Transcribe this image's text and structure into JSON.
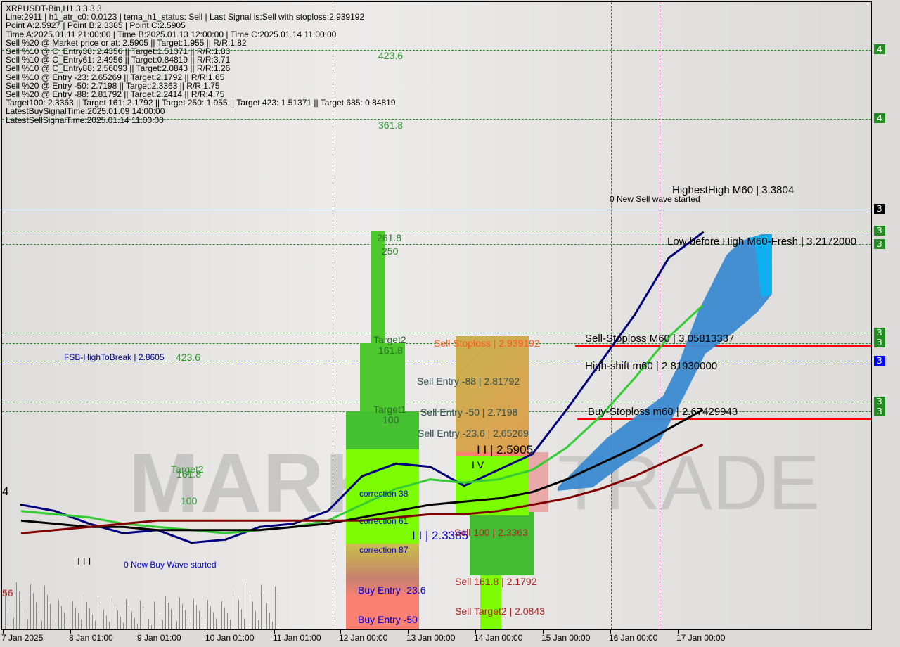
{
  "header": {
    "symbol_line": "XRPUSDT-Bin,H1  3 3 3 3",
    "info_lines": [
      "Line:2911 | h1_atr_c0: 0.0123 | tema_h1_status: Sell | Last Signal is:Sell with stoploss:2.939192",
      "Point A:2.5927 | Point B:2.3385 | Point C:2.5905",
      "Time A:2025.01.11 21:00:00 | Time B:2025.01.13 12:00:00 | Time C:2025.01.14 11:00:00",
      "Sell %20 @ Market price or at: 2.5905 || Target:1.955 || R/R:1.82",
      "Sell %10 @ C_Entry38: 2.4356 || Target:1.51371 || R/R:1.83",
      "Sell %10 @ C_Entry61: 2.4956 || Target:0.84819 || R/R:3.71",
      "Sell %10 @ C_Entry88: 2.56093 || Target:2.0843 || R/R:1.26",
      "Sell %10 @ Entry -23: 2.65269 || Target:2.1792 || R/R:1.65",
      "Sell %20 @ Entry -50: 2.7198 || Target:2.3363 || R/R:1.75",
      "Sell %20 @ Entry -88: 2.81792 || Target:2.2414 || R/R:4.75",
      "Target100: 2.3363 || Target 161: 2.1792 || Target 250: 1.955 || Target 423: 1.51371 || Target 685: 0.84819",
      "LatestBuySignalTime:2025.01.09 14:00:00",
      "LatestSellSignalTime:2025.01.14 11:00:00"
    ]
  },
  "watermark": "MARKET TRADE",
  "labels": {
    "l423a": "423.6",
    "l361": "361.8",
    "l261": "261.8",
    "l250": "250",
    "target2": "Target2",
    "t161": "161.8",
    "target1": "Target1",
    "t100": "100",
    "fsb": "FSB-HighToBreak | 2.8605",
    "l423b": "423.6",
    "ltarget2": "Target2",
    "l161": "161.8",
    "l100": "100",
    "sell_stoploss": "Sell Stoploss | 2.939192",
    "sell_e88": "Sell Entry -88 | 2.81792",
    "sell_e50": "Sell Entry -50 | 2.7198",
    "sell_e236": "Sell Entry -23.6 | 2.65269",
    "pointc": "I I | 2.5905",
    "iv": "I V",
    "pointb": "I I | 2.3385",
    "sell100": "Sell 100 | 2.3363",
    "sell161": "Sell 161.8 | 2.1792",
    "sellt2": "Sell Target2 | 2.0843",
    "c38": "correction 38",
    "c61": "correction 61",
    "c87": "correction 87",
    "be236": "Buy Entry -23.6",
    "be50": "Buy Entry -50",
    "highesthigh": "HighestHigh    M60 | 3.3804",
    "newsell": "0 New Sell wave started",
    "lowbefore": "Low before High   M60-Fresh | 3.2172000",
    "sellsl": "Sell-Stoploss M60 | 3.05813337",
    "highshift": "High-shift m60 | 2.81930000",
    "buysl": "Buy-Stoploss m60 | 2.67429943",
    "newbuy": "0 New Buy Wave started",
    "left4": "4",
    "left56": "56",
    "iii": "I I I"
  },
  "axis_tags": [
    {
      "text": "4",
      "color": "#228b22"
    },
    {
      "text": "4",
      "color": "#228b22"
    },
    {
      "text": "3",
      "color": "#000000"
    },
    {
      "text": "3",
      "color": "#228b22"
    },
    {
      "text": "3",
      "color": "#228b22"
    },
    {
      "text": "3",
      "color": "#228b22"
    },
    {
      "text": "3",
      "color": "#228b22"
    },
    {
      "text": "3",
      "color": "#0000ff"
    },
    {
      "text": "3",
      "color": "#228b22"
    },
    {
      "text": "3",
      "color": "#228b22"
    }
  ],
  "chart_data": {
    "type": "line",
    "title": "XRPUSDT-Bin,H1",
    "x_ticks": [
      "7 Jan 2025",
      "8 Jan 01:00",
      "9 Jan 01:00",
      "10 Jan 01:00",
      "11 Jan 01:00",
      "12 Jan 00:00",
      "13 Jan 00:00",
      "14 Jan 00:00",
      "15 Jan 00:00",
      "16 Jan 00:00",
      "17 Jan 00:00"
    ],
    "x": [
      "2025-01-07 00:00",
      "2025-01-07 12:00",
      "2025-01-08 00:00",
      "2025-01-08 12:00",
      "2025-01-09 00:00",
      "2025-01-09 12:00",
      "2025-01-10 00:00",
      "2025-01-10 12:00",
      "2025-01-11 00:00",
      "2025-01-11 12:00",
      "2025-01-12 00:00",
      "2025-01-12 12:00",
      "2025-01-13 00:00",
      "2025-01-13 12:00",
      "2025-01-14 00:00",
      "2025-01-14 12:00",
      "2025-01-15 00:00",
      "2025-01-15 12:00",
      "2025-01-16 00:00",
      "2025-01-16 12:00",
      "2025-01-17 00:00"
    ],
    "series": [
      {
        "color": "#000080",
        "values": [
          2.42,
          2.4,
          2.36,
          2.33,
          2.34,
          2.3,
          2.31,
          2.35,
          2.36,
          2.4,
          2.51,
          2.55,
          2.54,
          2.48,
          2.53,
          2.58,
          2.72,
          2.87,
          3.02,
          3.2,
          3.28
        ]
      },
      {
        "color": "#33cc33",
        "values": [
          2.4,
          2.39,
          2.38,
          2.36,
          2.35,
          2.34,
          2.33,
          2.34,
          2.35,
          2.37,
          2.42,
          2.47,
          2.5,
          2.49,
          2.5,
          2.53,
          2.6,
          2.7,
          2.82,
          2.95,
          3.05
        ]
      },
      {
        "color": "#000000",
        "values": [
          2.37,
          2.36,
          2.35,
          2.35,
          2.34,
          2.34,
          2.34,
          2.34,
          2.35,
          2.36,
          2.38,
          2.4,
          2.42,
          2.43,
          2.44,
          2.46,
          2.5,
          2.55,
          2.6,
          2.66,
          2.72
        ]
      },
      {
        "color": "#800000",
        "values": [
          2.33,
          2.34,
          2.35,
          2.36,
          2.37,
          2.37,
          2.37,
          2.37,
          2.37,
          2.37,
          2.37,
          2.38,
          2.39,
          2.39,
          2.4,
          2.42,
          2.44,
          2.47,
          2.51,
          2.56,
          2.61
        ]
      }
    ],
    "levels": {
      "sell_stoploss": 2.939192,
      "point_c": 2.5905,
      "point_b": 2.3385,
      "highest_high": 3.3804,
      "low_before_high": 3.2172
    },
    "ylim": [
      1.95,
      4.0
    ],
    "grid": false
  }
}
